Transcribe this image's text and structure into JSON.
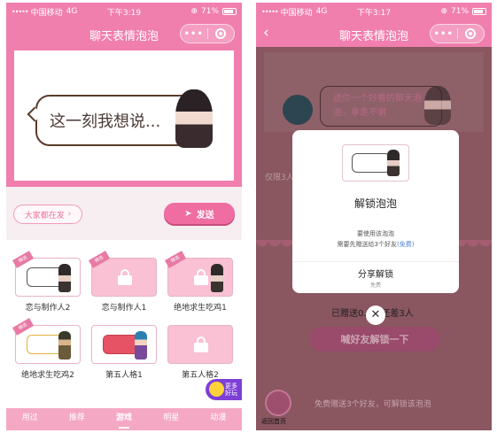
{
  "status_left": {
    "carrier": "中国移动",
    "network": "4G",
    "time": "下午3:19",
    "battery": "71%"
  },
  "status_right": {
    "carrier": "中国移动",
    "network": "4G",
    "time": "下午3:17",
    "battery": "71%"
  },
  "nav": {
    "title": "聊天表情泡泡",
    "capsule_dots": "•••"
  },
  "hero": {
    "bubble_text": "这一刻我想说..."
  },
  "actions": {
    "browse_label": "大家都在发",
    "send_label": "发送"
  },
  "grid": {
    "tag": "精选",
    "items": [
      {
        "label": "恋与制作人2"
      },
      {
        "label": "恋与制作人1"
      },
      {
        "label": "绝地求生吃鸡1"
      },
      {
        "label": "绝地求生吃鸡2"
      },
      {
        "label": "第五人格1"
      },
      {
        "label": "第五人格2"
      }
    ]
  },
  "more_badge": {
    "line1": "更多",
    "line2": "好玩"
  },
  "tabs": [
    {
      "label": "用过"
    },
    {
      "label": "推荐"
    },
    {
      "label": "游戏",
      "active": true
    },
    {
      "label": "明星"
    },
    {
      "label": "动漫"
    }
  ],
  "right": {
    "bubble_line1": "送你一个好看的聊天泡",
    "bubble_line2": "泡，拿走不谢",
    "faint_text": "仅限3人",
    "modal": {
      "title": "解锁泡泡",
      "desc1": "要使用该泡泡",
      "desc2": "需要先赠送给3个好友",
      "desc2_suffix": "(免费)",
      "share": "分享解锁",
      "share_sub": "免费"
    },
    "progress": {
      "sent": "已赠送0人，还差3人"
    },
    "cta": "喊好友解锁一下",
    "home_label": "返回首页",
    "free_note": "免费赠送3个好友，可解锁该泡泡"
  },
  "colors": {
    "brand_pink": "#f07fae",
    "tab_bar": "#f5a8c3",
    "more_badge": "#7d3fd6"
  }
}
